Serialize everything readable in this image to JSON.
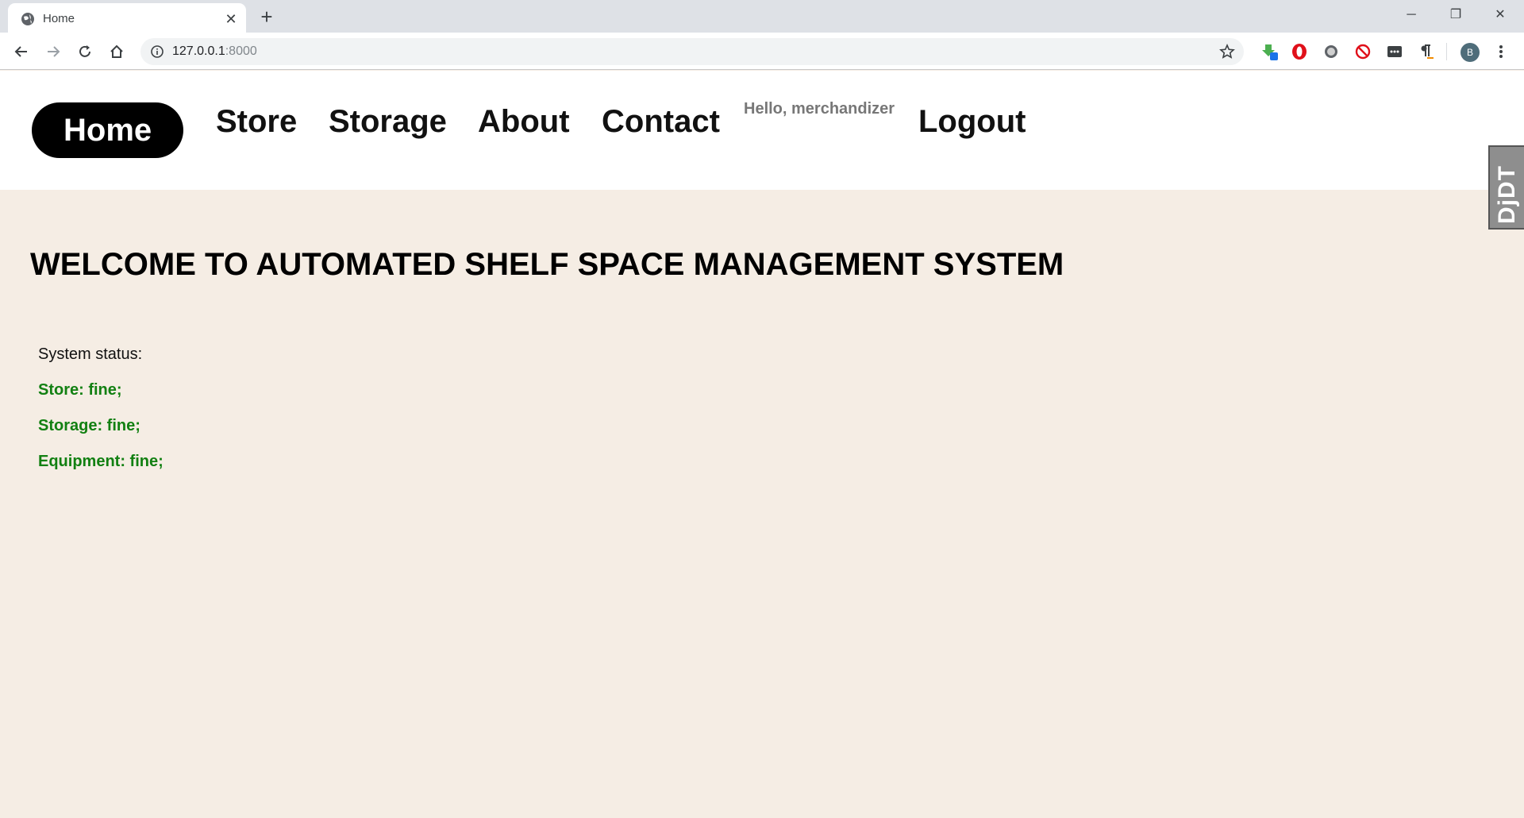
{
  "browser": {
    "tab_title": "Home",
    "url_host": "127.0.0.1",
    "url_port": ":8000",
    "profile_initial": "B"
  },
  "nav": {
    "items": [
      {
        "label": "Home",
        "active": true
      },
      {
        "label": "Store",
        "active": false
      },
      {
        "label": "Storage",
        "active": false
      },
      {
        "label": "About",
        "active": false
      },
      {
        "label": "Contact",
        "active": false
      }
    ],
    "greeting": "Hello, merchandizer",
    "logout": "Logout"
  },
  "main": {
    "title": "WELCOME TO AUTOMATED SHELF SPACE MANAGEMENT SYSTEM",
    "status_label": "System status:",
    "status_lines": [
      "Store: fine;",
      "Storage: fine;",
      "Equipment: fine;"
    ]
  },
  "side_widget": {
    "label": "DjDT"
  },
  "colors": {
    "page_background": "#f5ede4",
    "status_ok": "#128012",
    "nav_active_bg": "#000000"
  }
}
